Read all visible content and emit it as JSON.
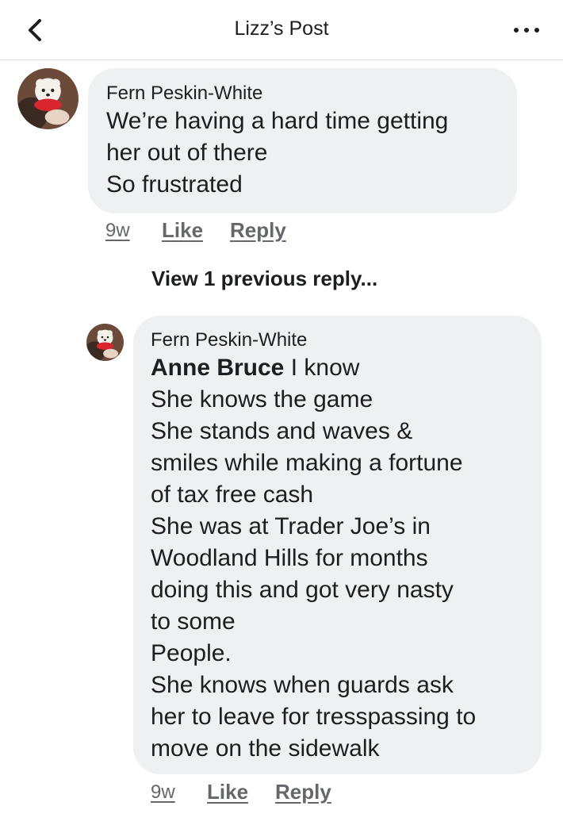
{
  "header": {
    "title": "Lizz’s Post"
  },
  "comment": {
    "author": "Fern Peskin-White",
    "lines": [
      "We’re having a hard time getting",
      "her out of there",
      "So frustrated"
    ],
    "time": "9w",
    "like_label": "Like",
    "reply_label": "Reply"
  },
  "view_previous": "View 1 previous reply...",
  "reply": {
    "author": "Fern Peskin-White",
    "mention": "Anne Bruce",
    "first_line_rest": " I know",
    "lines": [
      "She knows the game",
      "She stands and waves &",
      "smiles while making a fortune",
      "of tax free cash",
      "She was at Trader Joe’s in",
      "Woodland Hills for months",
      "doing this and got very nasty",
      "to some",
      "People.",
      "She knows when guards ask",
      "her to leave for tresspassing to",
      "move on the sidewalk"
    ],
    "time": "9w",
    "like_label": "Like",
    "reply_label": "Reply"
  }
}
